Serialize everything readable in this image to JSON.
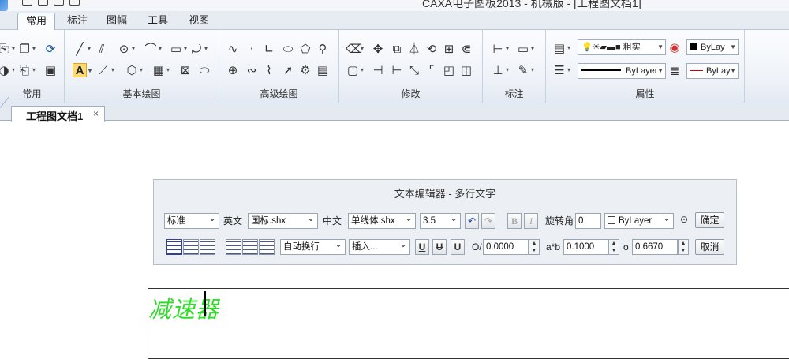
{
  "window": {
    "title": "CAXA电子图板2013 - 机械版 - [工程图文档1]"
  },
  "ribbon_tabs": [
    "常用",
    "标注",
    "图幅",
    "工具",
    "视图"
  ],
  "ribbon_groups": {
    "common": {
      "label": "常用"
    },
    "basic_draw": {
      "label": "基本绘图"
    },
    "advanced_draw": {
      "label": "高级绘图"
    },
    "modify": {
      "label": "修改"
    },
    "dimension": {
      "label": "标注"
    },
    "properties": {
      "label": "属性",
      "layer_name": "粗实",
      "color_value": "ByLay",
      "linetype_value": "ByLayer",
      "lineweight_value": "ByLay"
    }
  },
  "doc_tab": {
    "label": "工程图文档1",
    "close": "×"
  },
  "text_editor": {
    "title": "文本编辑器 - 多行文字",
    "style": "标准",
    "english_label": "英文",
    "english_font": "国标.shx",
    "chinese_label": "中文",
    "chinese_font": "单线体.shx",
    "height": "3.5",
    "bold_label": "B",
    "italic_label": "I",
    "rotation_label": "旋转角",
    "rotation_value": "0",
    "color": "ByLayer",
    "ok_label": "确定",
    "wrap_mode": "自动换行",
    "insert_label": "插入...",
    "underline_label": "U",
    "strike_label": "U",
    "overline_label": "U",
    "oblique_label": "O/",
    "oblique_value": "0.0000",
    "width_factor_label": "a*b",
    "width_factor_value": "0.1000",
    "spacing_label": "o",
    "spacing_value": "0.6670",
    "cancel_label": "取消"
  },
  "canvas_text": "减速器"
}
